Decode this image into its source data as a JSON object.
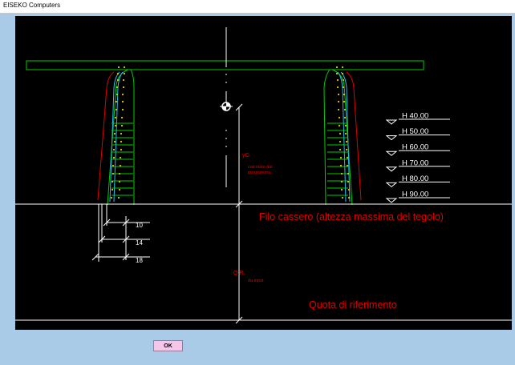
{
  "window": {
    "title": "EISEKO Computers"
  },
  "drawing": {
    "level_labels": [
      "H  40.00",
      "H  50.00",
      "H  60.00",
      "H  70.00",
      "H  80.00",
      "H  90.00"
    ],
    "dimension_labels": [
      "10",
      "14",
      "18"
    ],
    "yg_label": "yG",
    "yg_note_line1": "calcolato dal",
    "yg_note_line2": "programma",
    "qr_label": "Q.R.",
    "qr_note": "da input",
    "filo_cassero": "Filo cassero (altezza massima del tegolo)",
    "quota_riferimento": "Quota di riferimento"
  },
  "buttons": {
    "ok_label": "OK"
  },
  "colors": {
    "background": "#a9cbe8",
    "canvas": "#000000",
    "beam_outline": "#00cc00",
    "annotation": "#e00000",
    "strand": "#e6c800",
    "mesh": "#22c0f0",
    "ok_button": "#f4c6ea"
  }
}
